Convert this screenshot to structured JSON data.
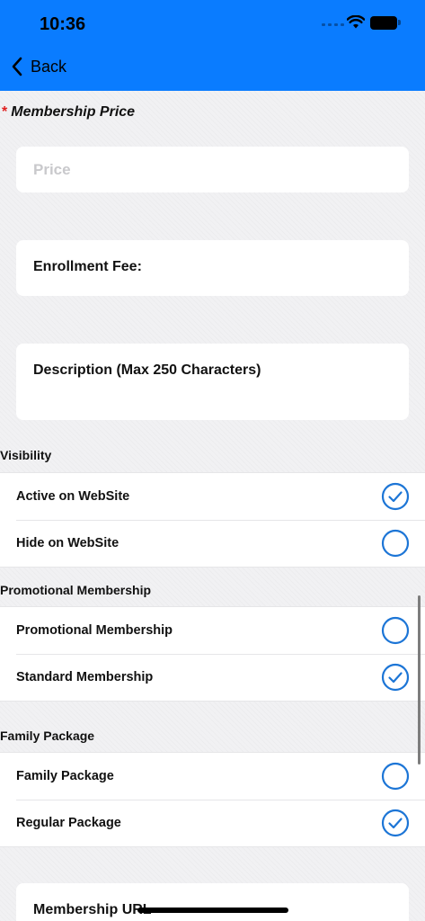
{
  "status_bar": {
    "time": "10:36"
  },
  "nav": {
    "back_label": "Back"
  },
  "price_section": {
    "required_marker": "*",
    "label": "Membership Price",
    "placeholder": "Price"
  },
  "enrollment": {
    "label": "Enrollment Fee:"
  },
  "description": {
    "label": "Description (Max 250 Characters)"
  },
  "visibility": {
    "title": "Visibility",
    "options": [
      {
        "label": "Active on WebSite",
        "selected": true
      },
      {
        "label": "Hide on WebSite",
        "selected": false
      }
    ]
  },
  "promotional": {
    "title": "Promotional Membership",
    "options": [
      {
        "label": "Promotional Membership",
        "selected": false
      },
      {
        "label": "Standard Membership",
        "selected": true
      }
    ]
  },
  "family": {
    "title": "Family Package",
    "options": [
      {
        "label": "Family Package",
        "selected": false
      },
      {
        "label": "Regular Package",
        "selected": true
      }
    ]
  },
  "membership_url": {
    "label": "Membership URL"
  },
  "colors": {
    "accent": "#0a7cff",
    "radio": "#1c75d6",
    "required": "#e02020"
  },
  "icons": {
    "back": "chevron-left-icon",
    "selected": "checkmark-circle-icon",
    "unselected": "empty-circle-icon"
  }
}
